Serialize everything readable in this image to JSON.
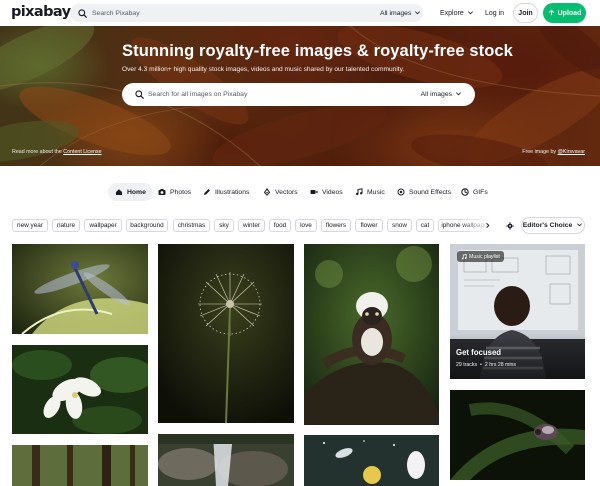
{
  "brand": {
    "logo_text": "pixabay",
    "accent": "#02be6e"
  },
  "topnav": {
    "search_placeholder": "Search Pixabay",
    "type_filter": "All images",
    "explore": "Explore",
    "login": "Log in",
    "join": "Join",
    "upload": "Upload"
  },
  "hero": {
    "title": "Stunning royalty-free images & royalty-free stock",
    "subtitle": "Over 4.3 million+ high quality stock images, videos and music shared by our talented community.",
    "search_placeholder": "Search for all images on Pixabay",
    "type_filter": "All images",
    "license_prefix": "Read more about the",
    "license_link": "Content License",
    "credit_prefix": "Free image by",
    "credit_author": "@Kirsvavar"
  },
  "tabs": [
    {
      "label": "Home",
      "icon": "home-icon",
      "active": true
    },
    {
      "label": "Photos",
      "icon": "camera-icon",
      "active": false
    },
    {
      "label": "Illustrations",
      "icon": "pen-icon",
      "active": false
    },
    {
      "label": "Vectors",
      "icon": "vector-icon",
      "active": false
    },
    {
      "label": "Videos",
      "icon": "video-icon",
      "active": false
    },
    {
      "label": "Music",
      "icon": "music-note-icon",
      "active": false
    },
    {
      "label": "Sound Effects",
      "icon": "sound-effects-icon",
      "active": false
    },
    {
      "label": "GIFs",
      "icon": "gif-icon",
      "active": false
    }
  ],
  "tags": [
    "new year",
    "nature",
    "wallpaper",
    "background",
    "christmas",
    "sky",
    "winter",
    "food",
    "love",
    "flowers",
    "flower",
    "snow",
    "cat",
    "iphone wallpaper"
  ],
  "sort": {
    "label": "Editor's Choice"
  },
  "playlist": {
    "badge": "Music playlist",
    "title": "Get focused",
    "tracks": "29 tracks",
    "duration": "2 hrs 28 mins"
  },
  "images": [
    {
      "subject": "dragonfly-on-leaf"
    },
    {
      "subject": "dandelion-seedhead"
    },
    {
      "subject": "cotton-top-tamarin"
    },
    {
      "subject": "white-flowers"
    },
    {
      "subject": "insect-on-leaf"
    },
    {
      "subject": "forest"
    },
    {
      "subject": "waterfall-rocks"
    },
    {
      "subject": "space-illustration"
    }
  ]
}
